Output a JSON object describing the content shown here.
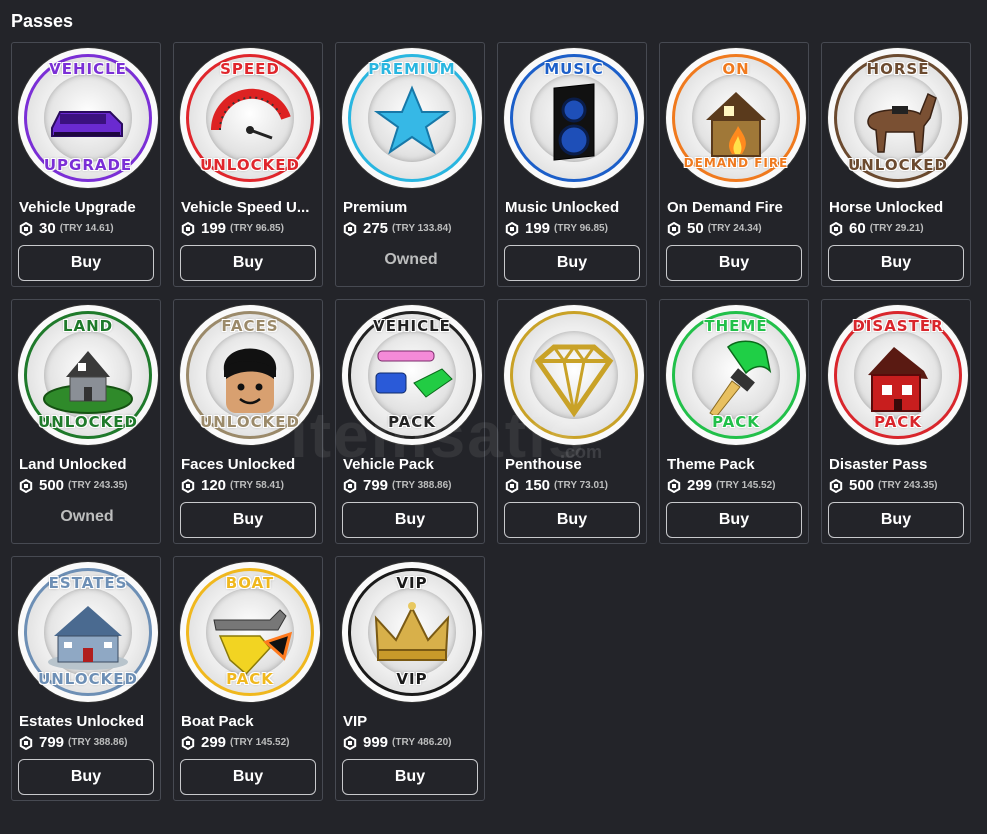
{
  "section": {
    "title": "Passes"
  },
  "owned_label": "Owned",
  "buy_label": "Buy",
  "watermark": {
    "text": "itemsatis",
    "sub": ".com"
  },
  "passes": [
    {
      "name": "Vehicle Upgrade",
      "price": "30",
      "try": "(TRY 14.61)",
      "status": "buy",
      "badge_top": "VEHICLE",
      "badge_bottom": "UPGRADE",
      "color": "#7b2fd6",
      "icon": "car-icon"
    },
    {
      "name": "Vehicle Speed U...",
      "price": "199",
      "try": "(TRY 96.85)",
      "status": "buy",
      "badge_top": "SPEED",
      "badge_bottom": "UNLOCKED",
      "color": "#e0262c",
      "icon": "speedometer-icon"
    },
    {
      "name": "Premium",
      "price": "275",
      "try": "(TRY 133.84)",
      "status": "owned",
      "badge_top": "PREMIUM",
      "badge_bottom": "",
      "color": "#29b6e0",
      "icon": "star-icon"
    },
    {
      "name": "Music Unlocked",
      "price": "199",
      "try": "(TRY 96.85)",
      "status": "buy",
      "badge_top": "MUSIC",
      "badge_bottom": "",
      "color": "#1c5fc9",
      "icon": "speaker-icon"
    },
    {
      "name": "On Demand Fire",
      "price": "50",
      "try": "(TRY 24.34)",
      "status": "buy",
      "badge_top": "ON",
      "badge_bottom": "DEMAND FIRE",
      "color": "#f07a1e",
      "icon": "burning-house-icon"
    },
    {
      "name": "Horse Unlocked",
      "price": "60",
      "try": "(TRY 29.21)",
      "status": "buy",
      "badge_top": "HORSE",
      "badge_bottom": "UNLOCKED",
      "color": "#6b4a2f",
      "icon": "horse-icon"
    },
    {
      "name": "Land Unlocked",
      "price": "500",
      "try": "(TRY 243.35)",
      "status": "owned",
      "badge_top": "LAND",
      "badge_bottom": "UNLOCKED",
      "color": "#1f7a2b",
      "icon": "land-house-icon"
    },
    {
      "name": "Faces Unlocked",
      "price": "120",
      "try": "(TRY 58.41)",
      "status": "buy",
      "badge_top": "FACES",
      "badge_bottom": "UNLOCKED",
      "color": "#9b8a6a",
      "icon": "face-icon"
    },
    {
      "name": "Vehicle Pack",
      "price": "799",
      "try": "(TRY 388.86)",
      "status": "buy",
      "badge_top": "VEHICLE",
      "badge_bottom": "PACK",
      "color": "#222222",
      "icon": "vehicles-icon"
    },
    {
      "name": "Penthouse",
      "price": "150",
      "try": "(TRY 73.01)",
      "status": "buy",
      "badge_top": "",
      "badge_bottom": "",
      "color": "#c9a227",
      "icon": "diamond-icon"
    },
    {
      "name": "Theme Pack",
      "price": "299",
      "try": "(TRY 145.52)",
      "status": "buy",
      "badge_top": "THEME",
      "badge_bottom": "PACK",
      "color": "#22c04a",
      "icon": "paintbrush-icon"
    },
    {
      "name": "Disaster Pass",
      "price": "500",
      "try": "(TRY 243.35)",
      "status": "buy",
      "badge_top": "DISASTER",
      "badge_bottom": "PACK",
      "color": "#d9262c",
      "icon": "ruined-house-icon"
    },
    {
      "name": "Estates Unlocked",
      "price": "799",
      "try": "(TRY 388.86)",
      "status": "buy",
      "badge_top": "ESTATES",
      "badge_bottom": "UNLOCKED",
      "color": "#6d8fb5",
      "icon": "estate-house-icon"
    },
    {
      "name": "Boat Pack",
      "price": "299",
      "try": "(TRY 145.52)",
      "status": "buy",
      "badge_top": "BOAT",
      "badge_bottom": "PACK",
      "color": "#f0b81e",
      "icon": "boat-icon"
    },
    {
      "name": "VIP",
      "price": "999",
      "try": "(TRY 486.20)",
      "status": "buy",
      "badge_top": "VIP",
      "badge_bottom": "VIP",
      "color": "#1a1a1a",
      "icon": "crown-icon"
    }
  ]
}
